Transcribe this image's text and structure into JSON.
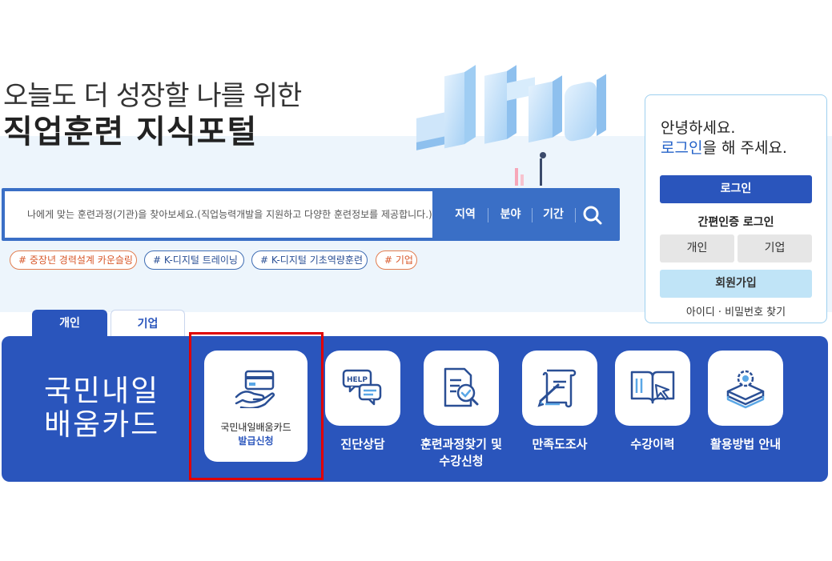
{
  "hero": {
    "line1": "오늘도 더 성장할 나를 위한",
    "line2": "직업훈련 지식포털"
  },
  "search": {
    "placeholder": "나에게 맞는 훈련과정(기관)을 찾아보세요.(직업능력개발을 지원하고 다양한 훈련정보를 제공합니다.)",
    "region_label": "지역",
    "field_label": "분야",
    "period_label": "기간"
  },
  "tags": [
    {
      "label": "# 중장년 경력설계 카운슬링",
      "color": "#d8582a"
    },
    {
      "label": "# K-디지털 트레이닝",
      "color": "#2a4f95"
    },
    {
      "label": "# K-디지털 기초역량훈련",
      "color": "#2a4f95"
    },
    {
      "label": "# 기업",
      "color": "#d8582a"
    }
  ],
  "login": {
    "greeting1": "안녕하세요.",
    "greeting2_link": "로그인",
    "greeting2_rest": "을 해 주세요.",
    "login_button": "로그인",
    "simple_auth_title": "간편인증 로그인",
    "personal_button": "개인",
    "company_button": "기업",
    "join_button": "회원가입",
    "find_link": "아이디 · 비밀번호 찾기"
  },
  "tabs": {
    "personal": "개인",
    "company": "기업"
  },
  "panel": {
    "title_line1": "국민내일",
    "title_line2": "배움카드",
    "feature_card": {
      "line1": "국민내일배움카드",
      "line2": "발급신청",
      "icon": "card-hand-icon"
    },
    "services": [
      {
        "label": "진단상담",
        "icon": "help-chat-icon"
      },
      {
        "label1": "훈련과정찾기 및",
        "label2": "수강신청",
        "icon": "document-search-icon"
      },
      {
        "label": "만족도조사",
        "icon": "survey-pen-icon"
      },
      {
        "label": "수강이력",
        "icon": "book-cursor-icon"
      },
      {
        "label": "활용방법 안내",
        "icon": "gear-stack-icon"
      }
    ]
  },
  "colors": {
    "primary": "#2a55bc",
    "search_bg": "#3a6fc6",
    "accent_link": "#2563c9",
    "highlight": "#e00000",
    "join_bg": "#c0e4f7"
  }
}
